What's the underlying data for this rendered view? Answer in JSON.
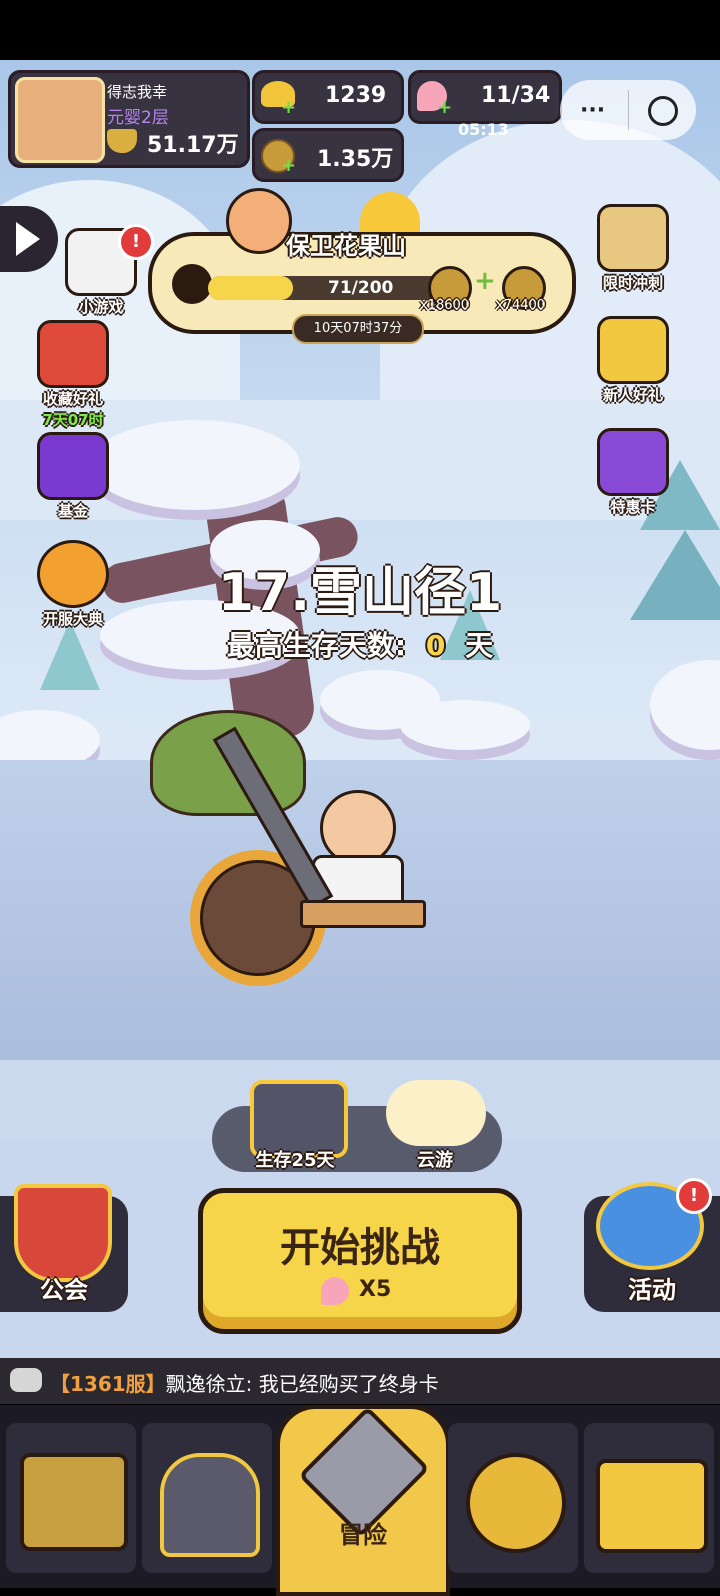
{
  "player": {
    "name": "得志我幸",
    "realm": "元婴2层",
    "power": "51.17万"
  },
  "currency": {
    "gold": "1239",
    "coins": "1.35万",
    "stamina": "11/34",
    "stamina_timer": "05:13"
  },
  "event": {
    "title": "保卫花果山",
    "progress_text": "71/200",
    "progress": 0.355,
    "reward1": "x18600",
    "reward2": "x74400",
    "time_left": "10天07时37分"
  },
  "left_menu": [
    {
      "label": "小游戏",
      "sub": ""
    },
    {
      "label": "收藏好礼",
      "sub": "7天07时"
    },
    {
      "label": "基金",
      "sub": ""
    },
    {
      "label": "开服大典",
      "sub": ""
    }
  ],
  "right_menu": [
    {
      "label": "限时冲刺"
    },
    {
      "label": "新人好礼"
    },
    {
      "label": "特惠卡"
    }
  ],
  "stage": {
    "name": "17.雪山径1",
    "best_label": "最高生存天数:",
    "best_value": "0",
    "best_unit": "天"
  },
  "actions": {
    "chest_label": "生存25天",
    "cloud_label": "云游",
    "start_label": "开始挑战",
    "start_cost": "X5",
    "guild_label": "公会",
    "activity_label": "活动"
  },
  "chat": {
    "server": "【1361服】",
    "message": "飘逸徐立: 我已经购买了终身卡"
  },
  "nav": {
    "active_label": "冒险"
  },
  "colors": {
    "accent_yellow": "#f7d54a",
    "badge_red": "#e23b3b",
    "dark_panel": "#2a1c24"
  }
}
